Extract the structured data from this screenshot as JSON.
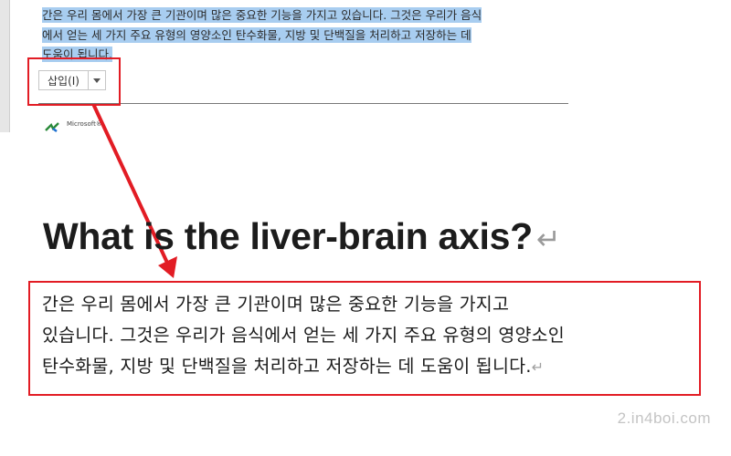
{
  "top_pane": {
    "selected_paragraph_line1": "간은 우리 몸에서 가장 큰 기관이며 많은 중요한 기능을 가지고 있습니다. 그것은 우리가 음식",
    "selected_paragraph_line2": "에서 얻는 세 가지 주요 유형의 영양소인 탄수화물, 지방 및 단백질을 처리하고 저장하는 데",
    "selected_paragraph_line3": "도움이 됩니다.",
    "paste_button_label": "삽입(I)",
    "logo_text": "Microsoft®",
    "selection_color": "#a8cdf0"
  },
  "zoom": {
    "heading": "What is the liver-brain axis?",
    "paragraph_line1": "간은 우리 몸에서 가장 큰 기관이며 많은 중요한 기능을 가지고",
    "paragraph_line2": "있습니다. 그것은 우리가 음식에서 얻는 세 가지 주요 유형의 영양소인",
    "paragraph_line3": "탄수화물, 지방 및 단백질을 처리하고 저장하는 데 도움이 됩니다."
  },
  "annotation": {
    "highlight_color": "#e21c24"
  },
  "watermark": "2.in4boi.com"
}
